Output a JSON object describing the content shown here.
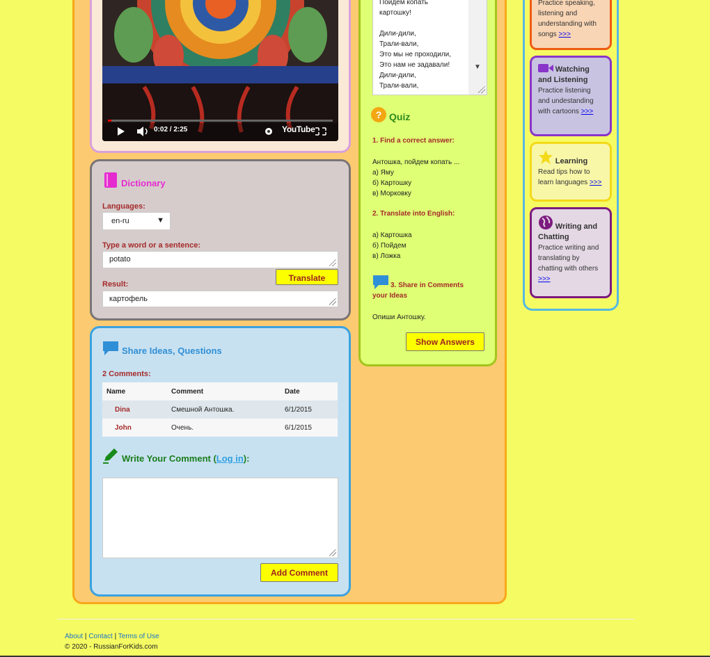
{
  "video": {
    "time": "0:02 / 2:25",
    "brand": "YouTube"
  },
  "dictionary": {
    "title": "Dictionary",
    "languages_label": "Languages:",
    "language_value": "en-ru",
    "input_label": "Type a word or a sentence:",
    "input_value": "potato",
    "translate_label": "Translate",
    "result_label": "Result:",
    "result_value": "картофель"
  },
  "share": {
    "title": "Share Ideas, Questions",
    "count_label": "2 Comments:",
    "columns": [
      "Name",
      "Comment",
      "Date"
    ],
    "rows": [
      {
        "name": "Dina",
        "comment": "Смешной Антошка.",
        "date": "6/1/2015"
      },
      {
        "name": "John",
        "comment": "Очень.",
        "date": "6/1/2015"
      }
    ],
    "write_prefix": "Write Your Comment (",
    "login_label": "Log in",
    "write_suffix": "):",
    "add_comment_label": "Add Comment"
  },
  "lyrics": {
    "lines": [
      "Пойдем копать",
      "картошку!",
      "",
      "Дили-дили,",
      "Трали-вали,",
      "Это мы не проходили,",
      "Это нам не задавали!",
      "Дили-дили,",
      "Трали-вали,"
    ]
  },
  "quiz": {
    "title": "Quiz",
    "q1_title": "1. Find a correct answer:",
    "q1_prompt": "Антошка, пойдем копать ...",
    "q1_options": [
      "а) Яму",
      "б) Картошку",
      "в) Морковку"
    ],
    "q2_title": "2. Translate into English:",
    "q2_options": [
      "а) Картошка",
      "б) Пойдем",
      "в) Ложка"
    ],
    "q3_title": "3. Share in Comments",
    "q3_title_2": "your Ideas",
    "q3_text": "Опиши Антошку.",
    "show_answers_label": "Show Answers"
  },
  "sidebar": {
    "cards": [
      {
        "title": "",
        "text_lines": [
          "Practice speaking,",
          "listening and",
          "understanding with"
        ],
        "tail": "songs ",
        "link": ">>>",
        "bg": "#f8d5b4",
        "border": "#f05a12"
      },
      {
        "title": "Watching and Listening",
        "text_lines": [
          "Practice listening",
          "and undestanding"
        ],
        "tail": "with cartoons ",
        "link": ">>>",
        "bg": "#c9c3e2",
        "border": "#8a35c9"
      },
      {
        "title": "Learning",
        "text_lines": [
          "Read tips how to"
        ],
        "tail": "learn languages ",
        "link": ">>>",
        "bg": "#f8f7a8",
        "border": "#f3d91a"
      },
      {
        "title": "Writing and Chatting",
        "text_lines": [
          "Practice writing and",
          "translating by",
          "chatting with others"
        ],
        "tail": "",
        "link": ">>>",
        "bg": "#e3d8e4",
        "border": "#7c1b7e"
      }
    ]
  },
  "footer": {
    "links": [
      "About",
      "Contact",
      "Terms of Use"
    ],
    "separator": "|",
    "copyright": "© 2020 - RussianForKids.com"
  },
  "colors": {
    "page_bg": "#f5fb62",
    "accent_red": "#a52a2a",
    "dictionary_magenta": "#e52bd0",
    "share_blue": "#2f8fd6",
    "quiz_green": "#2e8b1c",
    "button_yellow": "#fbff00"
  }
}
